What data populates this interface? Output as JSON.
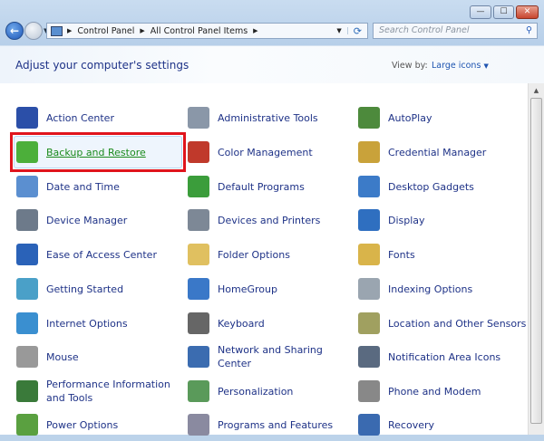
{
  "window": {
    "minimize": "—",
    "maximize": "☐",
    "close": "✕"
  },
  "address": {
    "crumbs": [
      "Control Panel",
      "All Control Panel Items"
    ],
    "search_placeholder": "Search Control Panel"
  },
  "header": {
    "title": "Adjust your computer's settings",
    "view_by_label": "View by:",
    "view_by_value": "Large icons"
  },
  "items": [
    {
      "label": "Action Center",
      "color": "#2b4fa8"
    },
    {
      "label": "Administrative Tools",
      "color": "#8a97a8"
    },
    {
      "label": "AutoPlay",
      "color": "#4d8a3c"
    },
    {
      "label": "Backup and Restore",
      "color": "#4caf3a",
      "selected": true
    },
    {
      "label": "Color Management",
      "color": "#c0392b"
    },
    {
      "label": "Credential Manager",
      "color": "#c9a23a"
    },
    {
      "label": "Date and Time",
      "color": "#5b8fd0"
    },
    {
      "label": "Default Programs",
      "color": "#3b9d3b"
    },
    {
      "label": "Desktop Gadgets",
      "color": "#3c7bc8"
    },
    {
      "label": "Device Manager",
      "color": "#6d7a8a"
    },
    {
      "label": "Devices and Printers",
      "color": "#7d8896"
    },
    {
      "label": "Display",
      "color": "#2f6fc0"
    },
    {
      "label": "Ease of Access Center",
      "color": "#2a62b8"
    },
    {
      "label": "Folder Options",
      "color": "#e0c060"
    },
    {
      "label": "Fonts",
      "color": "#d9b44a"
    },
    {
      "label": "Getting Started",
      "color": "#4aa0c8"
    },
    {
      "label": "HomeGroup",
      "color": "#3a78c8"
    },
    {
      "label": "Indexing Options",
      "color": "#9aa5b0"
    },
    {
      "label": "Internet Options",
      "color": "#3a8fd0"
    },
    {
      "label": "Keyboard",
      "color": "#666"
    },
    {
      "label": "Location and Other Sensors",
      "color": "#a0a060"
    },
    {
      "label": "Mouse",
      "color": "#999"
    },
    {
      "label": "Network and Sharing Center",
      "color": "#3b6cb0"
    },
    {
      "label": "Notification Area Icons",
      "color": "#5a6a80"
    },
    {
      "label": "Performance Information and Tools",
      "color": "#3a7a3a"
    },
    {
      "label": "Personalization",
      "color": "#5a9a5a"
    },
    {
      "label": "Phone and Modem",
      "color": "#888"
    },
    {
      "label": "Power Options",
      "color": "#5aa040"
    },
    {
      "label": "Programs and Features",
      "color": "#8a8aa0"
    },
    {
      "label": "Recovery",
      "color": "#3a6ab0"
    }
  ]
}
